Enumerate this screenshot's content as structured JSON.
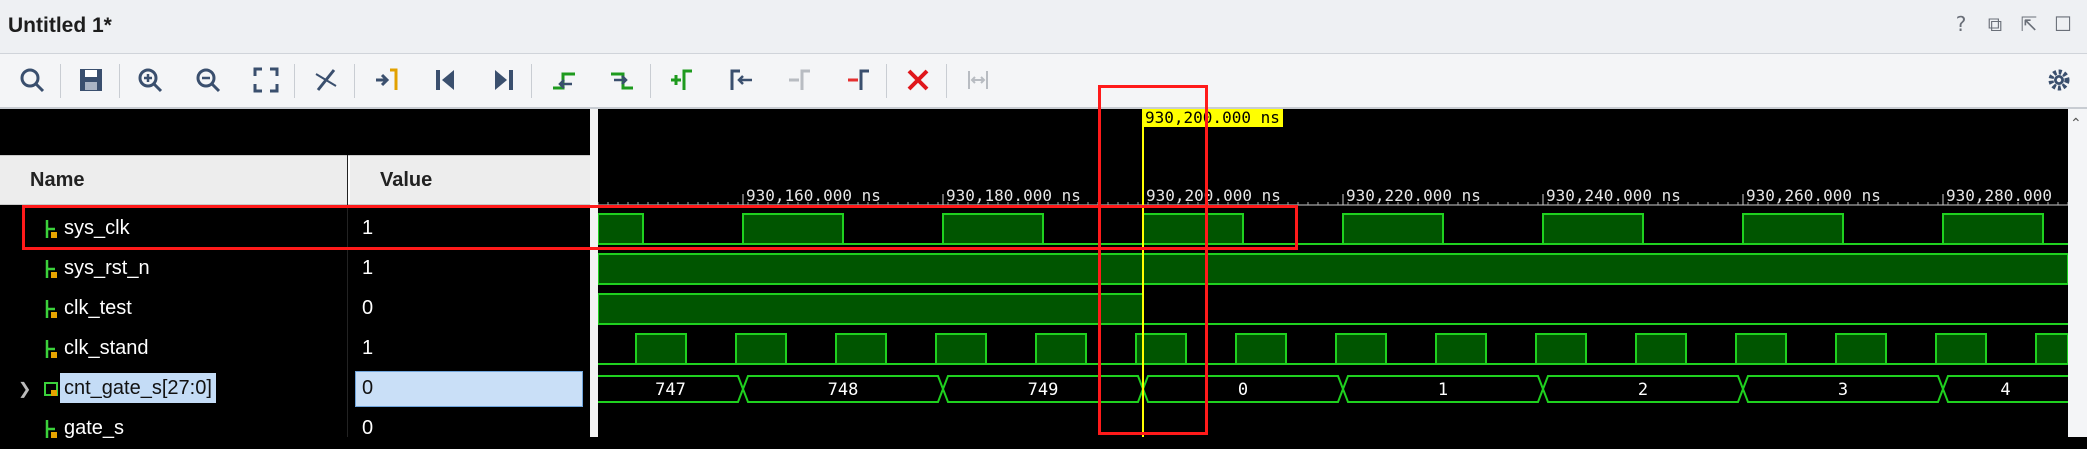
{
  "window": {
    "title": "Untitled 1*"
  },
  "window_controls": [
    {
      "icon": "help-icon",
      "glyph": "?"
    },
    {
      "icon": "restore-icon",
      "glyph": "⧉"
    },
    {
      "icon": "float-icon",
      "glyph": "⇱"
    },
    {
      "icon": "maximize-icon",
      "glyph": "☐"
    }
  ],
  "toolbar": [
    {
      "icon": "search-icon"
    },
    {
      "icon": "save-icon"
    },
    {
      "icon": "zoom-in-icon"
    },
    {
      "icon": "zoom-out-icon"
    },
    {
      "icon": "zoom-fit-icon"
    },
    {
      "icon": "snap-icon"
    },
    {
      "icon": "go-to-cursor-icon"
    },
    {
      "icon": "go-to-start-icon"
    },
    {
      "icon": "go-to-end-icon"
    },
    {
      "icon": "previous-transition-icon"
    },
    {
      "icon": "next-transition-icon"
    },
    {
      "icon": "add-marker-icon"
    },
    {
      "icon": "previous-marker-icon"
    },
    {
      "icon": "next-marker-icon"
    },
    {
      "icon": "remove-marker-icon"
    },
    {
      "icon": "delete-icon"
    },
    {
      "icon": "swap-cursors-icon"
    }
  ],
  "columns": {
    "name": "Name",
    "value": "Value"
  },
  "signals": [
    {
      "name": "sys_clk",
      "value": "1"
    },
    {
      "name": "sys_rst_n",
      "value": "1"
    },
    {
      "name": "clk_test",
      "value": "0"
    },
    {
      "name": "clk_stand",
      "value": "1"
    },
    {
      "name": "cnt_gate_s[27:0]",
      "value": "0",
      "bus": true,
      "selected": true
    },
    {
      "name": "gate_s",
      "value": "0"
    }
  ],
  "cursor": {
    "label": "930,200.000 ns"
  },
  "time_ruler": {
    "labels": [
      "930,160.000 ns",
      "930,180.000 ns",
      "930,200.000 ns",
      "930,220.000 ns",
      "930,240.000 ns",
      "930,260.000 ns",
      "930,280.000"
    ]
  },
  "bus_values": [
    "747",
    "748",
    "749",
    "0",
    "1",
    "2",
    "3",
    "4"
  ],
  "colors": {
    "wave_fill": "#005500",
    "wave_line": "#1fd11f",
    "cursor": "#ffff00",
    "annotation": "#ff1a1a",
    "selection": "#c4dcf6"
  }
}
